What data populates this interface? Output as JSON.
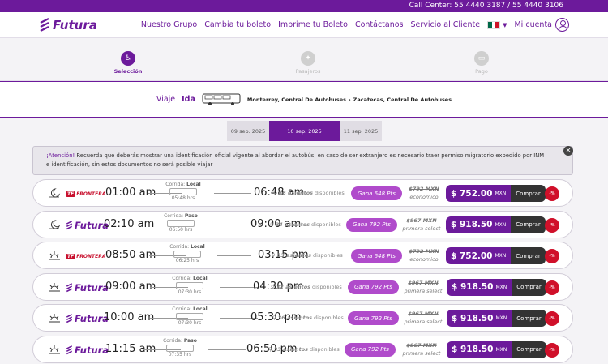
{
  "topbar": {
    "call_center": "Call Center:  55 4440 3187 / 55 4440 3106"
  },
  "header": {
    "logo_text": "Futura",
    "nav": [
      "Nuestro Grupo",
      "Cambia tu boleto",
      "Imprime tu Boleto",
      "Contáctanos",
      "Servicio al Cliente"
    ],
    "account": "Mi cuenta",
    "flag_colors": [
      "#006847",
      "#ffffff",
      "#ce1126"
    ]
  },
  "steps": [
    {
      "label": "Selección",
      "icon": "selection-icon",
      "active": true
    },
    {
      "label": "Pasajeros",
      "icon": "passenger-icon",
      "active": false
    },
    {
      "label": "Pago",
      "icon": "payment-icon",
      "active": false
    }
  ],
  "trip": {
    "prefix": "Viaje",
    "type": "Ida",
    "origin": "Monterrey, Central De Autobuses",
    "destination": "Zacatecas, Central De Autobuses"
  },
  "dates": [
    {
      "label": "09 sep. 2025",
      "active": false
    },
    {
      "label": "10 sep. 2025",
      "active": true
    },
    {
      "label": "11 sep. 2025",
      "active": false
    }
  ],
  "notice": {
    "title": "¡Atención!",
    "text": " Recuerda que deberás mostrar una identificación oficial vigente al abordar el autobús, en caso de ser extranjero es necesario traer permiso migratorio expedido por INM e identificación, sin estos documentos no será posible viajar"
  },
  "buy_label": "Comprar",
  "currency": "MXN",
  "seats_suffix": "disponibles",
  "discount_label": "-%",
  "colors": {
    "primary": "#6c1a9b",
    "points": "#b04bcb",
    "discount": "#d0102a",
    "frontera": "#c8102e"
  },
  "trips": [
    {
      "service_icon": "moon-icon",
      "brand": "frontera",
      "brand_text": "FRONTERA",
      "depart": "01:00 am",
      "class": "Local",
      "duration": "05:48 hrs",
      "arrive": "06:48 am",
      "seats": "35 asientos",
      "points": "Gana 648 Pts",
      "old_price": "$792 MXN",
      "fare": "economico",
      "price": "$ 752.00"
    },
    {
      "service_icon": "moon-icon",
      "brand": "futura",
      "brand_text": "Futura",
      "depart": "02:10 am",
      "class": "Paso",
      "duration": "06:50 hrs",
      "arrive": "09:00 am",
      "seats": "34 asientos",
      "points": "Gana 792 Pts",
      "old_price": "$967 MXN",
      "fare": "primera select",
      "price": "$ 918.50"
    },
    {
      "service_icon": "sunrise-icon",
      "brand": "frontera",
      "brand_text": "FRONTERA",
      "depart": "08:50 am",
      "class": "Local",
      "duration": "06:25 hrs",
      "arrive": "03:15 pm",
      "seats": "33 asientos",
      "points": "Gana 648 Pts",
      "old_price": "$792 MXN",
      "fare": "economico",
      "price": "$ 752.00"
    },
    {
      "service_icon": "sunrise-icon",
      "brand": "futura",
      "brand_text": "Futura",
      "depart": "09:00 am",
      "class": "Local",
      "duration": "07:30 hrs",
      "arrive": "04:30 pm",
      "seats": "32 asientos",
      "points": "Gana 792 Pts",
      "old_price": "$967 MXN",
      "fare": "primera select",
      "price": "$ 918.50"
    },
    {
      "service_icon": "sunrise-icon",
      "brand": "futura",
      "brand_text": "Futura",
      "depart": "10:00 am",
      "class": "Local",
      "duration": "07:30 hrs",
      "arrive": "05:30 pm",
      "seats": "36 asientos",
      "points": "Gana 792 Pts",
      "old_price": "$967 MXN",
      "fare": "primera select",
      "price": "$ 918.50"
    },
    {
      "service_icon": "sunrise-icon",
      "brand": "futura",
      "brand_text": "Futura",
      "depart": "11:15 am",
      "class": "Paso",
      "duration": "07:35 hrs",
      "arrive": "06:50 pm",
      "seats": "33 asientos",
      "points": "Gana 792 Pts",
      "old_price": "$967 MXN",
      "fare": "primera select",
      "price": "$ 918.50"
    }
  ]
}
